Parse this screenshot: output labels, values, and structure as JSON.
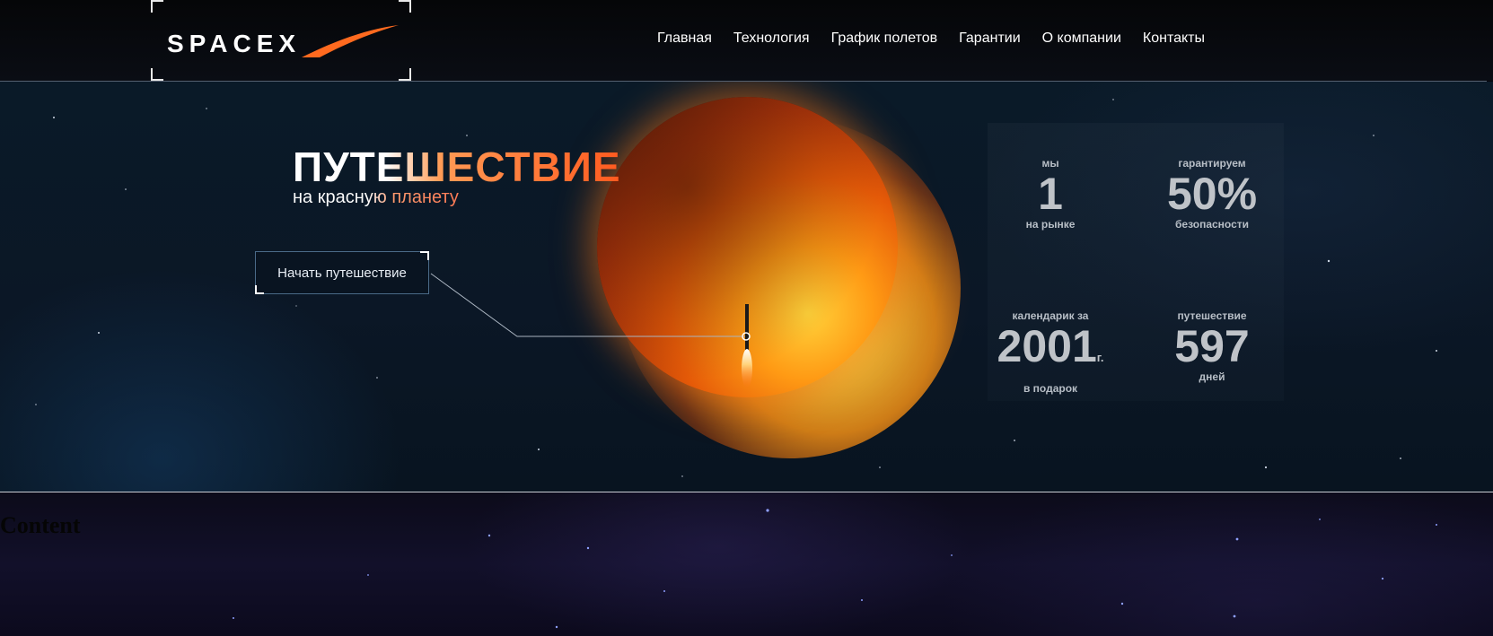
{
  "header": {
    "logo_text": "SPACEX",
    "nav": [
      "Главная",
      "Технология",
      "График полетов",
      "Гарантии",
      "О компании",
      "Контакты"
    ]
  },
  "hero": {
    "title": "ПУТЕШЕСТВИЕ",
    "subtitle": "на красную планету",
    "cta_label": "Начать путешествие"
  },
  "stats": [
    {
      "top": "мы",
      "value": "1",
      "unit": "",
      "bottom": "на рынке"
    },
    {
      "top": "гарантируем",
      "value": "50%",
      "unit": "",
      "bottom": "безопасности"
    },
    {
      "top": "календарик за",
      "value": "2001",
      "unit": "г.",
      "bottom": "в подарок"
    },
    {
      "top": "путешествие",
      "value": "597",
      "unit": "",
      "bottom": "дней"
    }
  ],
  "content": {
    "heading": "Content"
  },
  "colors": {
    "accent_orange": "#ff5a1f",
    "header_bg": "#05060a",
    "hero_bg": "#0b1726"
  }
}
